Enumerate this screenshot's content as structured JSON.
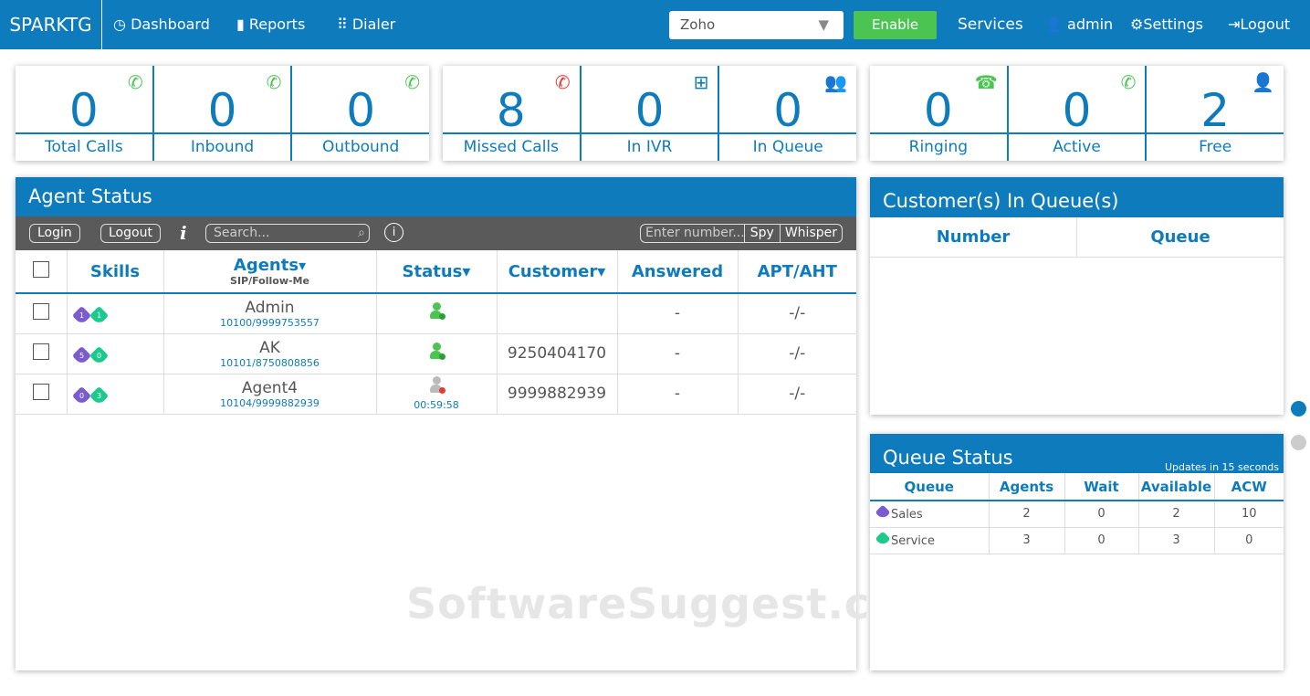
{
  "topbar": {
    "brand": "SPARKTG",
    "nav": [
      {
        "label": "Dashboard",
        "icon": "speedometer-icon"
      },
      {
        "label": "Reports",
        "icon": "bar-chart-icon"
      },
      {
        "label": "Dialer",
        "icon": "keypad-icon"
      }
    ],
    "crm_select": "Zoho",
    "enable": "Enable",
    "services": "Services",
    "user": "admin",
    "settings": "Settings",
    "logout": "Logout"
  },
  "stats": [
    [
      {
        "value": "0",
        "label": "Total Calls",
        "icon": "phone-icon"
      },
      {
        "value": "0",
        "label": "Inbound",
        "icon": "phone-incoming-icon"
      },
      {
        "value": "0",
        "label": "Outbound",
        "icon": "phone-outgoing-icon"
      }
    ],
    [
      {
        "value": "8",
        "label": "Missed Calls",
        "icon": "phone-missed-icon"
      },
      {
        "value": "0",
        "label": "In IVR",
        "icon": "ivr-tree-icon"
      },
      {
        "value": "0",
        "label": "In Queue",
        "icon": "people-queue-icon"
      }
    ],
    [
      {
        "value": "0",
        "label": "Ringing",
        "icon": "telephone-icon"
      },
      {
        "value": "0",
        "label": "Active",
        "icon": "phone-active-icon"
      },
      {
        "value": "2",
        "label": "Free",
        "icon": "user-free-icon"
      }
    ]
  ],
  "agent_status": {
    "title": "Agent Status",
    "login": "Login",
    "logout": "Logout",
    "search_placeholder": "Search...",
    "number_placeholder": "Enter number...",
    "spy": "Spy",
    "whisper": "Whisper",
    "columns": {
      "skills": "Skills",
      "agents": "Agents",
      "agents_sub": "SIP/Follow-Me",
      "status": "Status",
      "customer": "Customer",
      "answered": "Answered",
      "apt": "APT/AHT"
    },
    "rows": [
      {
        "name": "Admin",
        "sip": "10100/9999753557",
        "skill1": "1",
        "skill2": "1",
        "status": "available",
        "timer": "",
        "customer": "",
        "answered": "-",
        "apt": "-/-"
      },
      {
        "name": "AK",
        "sip": "10101/8750808856",
        "skill1": "5",
        "skill2": "0",
        "status": "available",
        "timer": "",
        "customer": "9250404170",
        "answered": "-",
        "apt": "-/-"
      },
      {
        "name": "Agent4",
        "sip": "10104/9999882939",
        "skill1": "0",
        "skill2": "3",
        "status": "busy",
        "timer": "00:59:58",
        "customer": "9999882939",
        "answered": "-",
        "apt": "-/-"
      }
    ]
  },
  "customers_queue": {
    "title": "Customer(s) In Queue(s)",
    "columns": [
      "Number",
      "Queue"
    ]
  },
  "queue_status": {
    "title": "Queue Status",
    "updates": "Updates in 15 seconds",
    "columns": [
      "Queue",
      "Agents",
      "Wait",
      "Available",
      "ACW"
    ],
    "rows": [
      {
        "queue": "Sales",
        "color": "#7b5ccf",
        "agents": "2",
        "wait": "0",
        "available": "2",
        "acw": "10"
      },
      {
        "queue": "Service",
        "color": "#1ec98e",
        "agents": "3",
        "wait": "0",
        "available": "3",
        "acw": "0"
      }
    ]
  },
  "watermark": "SoftwareSuggest.com",
  "colors": {
    "primary": "#0e7bbd",
    "green": "#4cc452",
    "purple": "#7b5ccf",
    "teal": "#1ec98e"
  }
}
